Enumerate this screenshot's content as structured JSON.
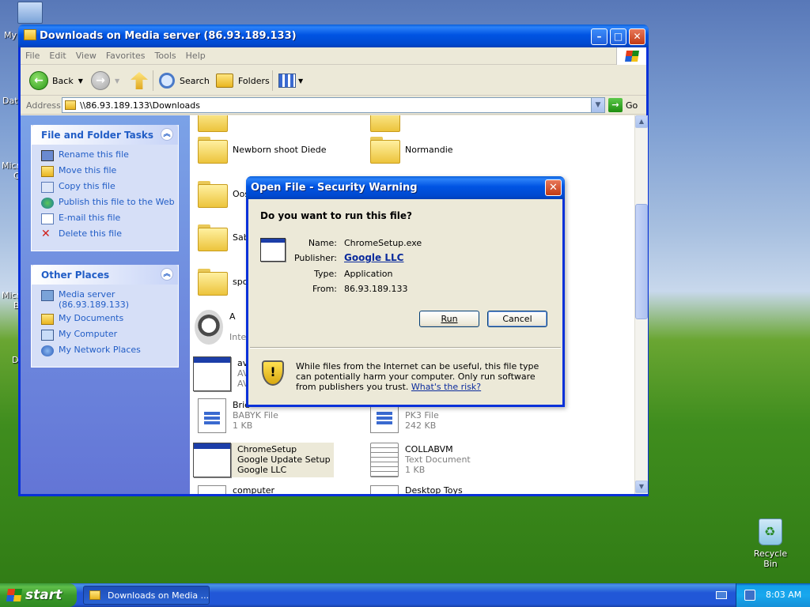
{
  "desktop": {
    "labels": [
      "My",
      "Dat",
      "Micro",
      "C",
      "Micro",
      "B",
      "D"
    ],
    "recycle_bin": "Recycle Bin"
  },
  "explorer": {
    "title": "Downloads on Media server (86.93.189.133)",
    "menu": [
      "File",
      "Edit",
      "View",
      "Favorites",
      "Tools",
      "Help"
    ],
    "toolbar": {
      "back": "Back",
      "search": "Search",
      "folders": "Folders"
    },
    "address": {
      "label": "Address",
      "value": "\\\\86.93.189.133\\Downloads",
      "go": "Go"
    },
    "file_tasks": {
      "title": "File and Folder Tasks",
      "items": [
        "Rename this file",
        "Move this file",
        "Copy this file",
        "Publish this file to the Web",
        "E-mail this file",
        "Delete this file"
      ]
    },
    "other_places": {
      "title": "Other Places",
      "items": [
        {
          "line1": "Media server",
          "line2": "(86.93.189.133)"
        },
        {
          "line1": "My Documents"
        },
        {
          "line1": "My Computer"
        },
        {
          "line1": "My Network Places"
        }
      ]
    },
    "files": {
      "newborn": "Newborn shoot Diede",
      "normandie": "Normandie",
      "oos": "Oos",
      "sab": "Sab",
      "spo": "spo",
      "a_name": "A",
      "a_sub": "Inte",
      "avg_name": "avg",
      "avg_sub1": "AVG",
      "avg_sub2": "AVG",
      "babyk_name": "Brie",
      "babyk_type": "BABYK File",
      "babyk_size": "1 KB",
      "pk3_type": "PK3 File",
      "pk3_size": "242 KB",
      "chrome_name": "ChromeSetup",
      "chrome_desc": "Google Update Setup",
      "chrome_company": "Google LLC",
      "collab_name": "COLLABVM",
      "collab_type": "Text Document",
      "collab_size": "1 KB",
      "computer_name": "computer",
      "desktop_toys": "Desktop Toys"
    }
  },
  "dialog": {
    "title": "Open File - Security Warning",
    "question": "Do you want to run this file?",
    "name_label": "Name:",
    "name_value": "ChromeSetup.exe",
    "publisher_label": "Publisher:",
    "publisher_value": "Google LLC",
    "type_label": "Type:",
    "type_value": "Application",
    "from_label": "From:",
    "from_value": "86.93.189.133",
    "run": "Run",
    "cancel": "Cancel",
    "warning": "While files from the Internet can be useful, this file type can potentially harm your computer. Only run software from publishers you trust.",
    "risk_link": "What's the risk?"
  },
  "taskbar": {
    "start": "start",
    "task": "Downloads on Media ...",
    "clock": "8:03 AM"
  }
}
